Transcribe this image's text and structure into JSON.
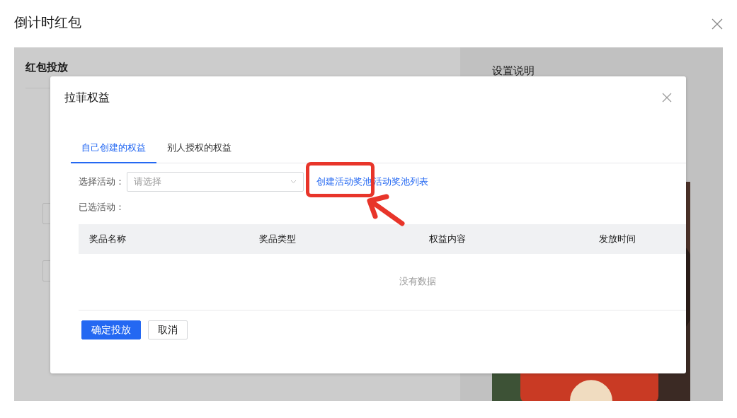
{
  "window": {
    "title": "倒计时红包"
  },
  "background": {
    "left_panel": {
      "heading": "红包投放"
    },
    "right_panel": {
      "heading": "设置说明"
    }
  },
  "dialog": {
    "title": "拉菲权益",
    "tabs": [
      {
        "label": "自己创建的权益",
        "selected": true
      },
      {
        "label": "别人授权的权益",
        "selected": false
      }
    ],
    "select_label": "选择活动：",
    "select_placeholder": "请选择",
    "links": [
      "创建活动奖池",
      "活动奖池列表"
    ],
    "selected_label": "已选活动：",
    "table": {
      "columns": [
        "奖品名称",
        "奖品类型",
        "权益内容",
        "发放时间"
      ],
      "empty_text": "没有数据"
    },
    "buttons": [
      {
        "label": "确定投放",
        "kind": "primary"
      },
      {
        "label": "取消",
        "kind": "default"
      }
    ]
  }
}
